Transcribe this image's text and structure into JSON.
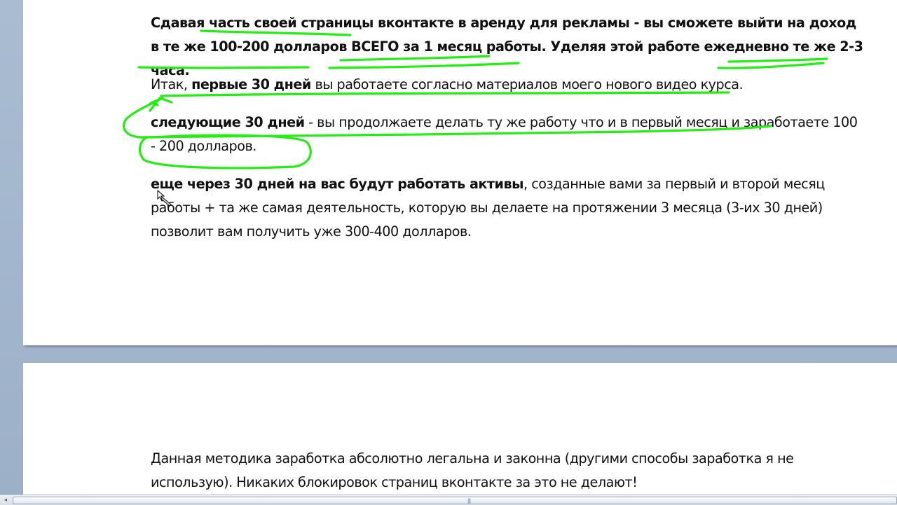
{
  "document": {
    "page1": {
      "p1": {
        "s1": "Сдавая часть своей страницы вконтакте",
        "s2": " в аренду для рекламы - вы сможете выйти на доход в те же 100-200 долларов ВСЕГО за 1 месяц работы. Уделяя этой работе ежедневно те же 2-3 часа."
      },
      "p2": {
        "s1": "Итак, ",
        "s2": "первые 30 дней",
        "s3": " вы работаете согласно материалов моего нового видео курса."
      },
      "p3": {
        "s1": "следующие 30 дней",
        "s2": " - вы продолжаете делать ту же работу что и в первый месяц и заработаете 100 - 200 долларов."
      },
      "p4": {
        "s1": "еще через 30 дней на вас будут работать активы",
        "s2": ", созданные вами за первый и второй месяц работы + та же самая деятельность, которую вы делаете на протяжении 3 месяца (3-их 30 дней) позволит вам получить уже 300-400 долларов."
      }
    },
    "page2": {
      "p1": "Данная методика заработка абсолютно легальна и законна (другими способы заработка я не использую). Никаких блокировок страниц вконтакте за это не делают!"
    }
  },
  "annotation_color": "#22ee11",
  "icons": {
    "scroll_left": "chevron-left-icon",
    "scroll_grip": "grip-icon",
    "cursor": "pen-cursor-icon"
  }
}
